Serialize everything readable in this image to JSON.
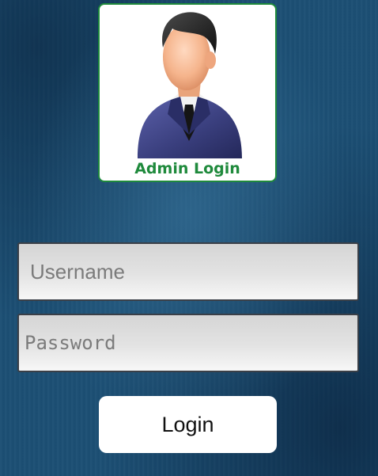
{
  "logo": {
    "caption": "Admin Login",
    "icon": "admin-avatar-icon",
    "border_color": "#1f8a3c"
  },
  "form": {
    "username": {
      "placeholder": "Username",
      "value": ""
    },
    "password": {
      "placeholder": "Password",
      "value": ""
    },
    "login_label": "Login"
  },
  "colors": {
    "background": "#1c4f74",
    "suit": "#3a3f7e",
    "button_bg": "#ffffff"
  }
}
